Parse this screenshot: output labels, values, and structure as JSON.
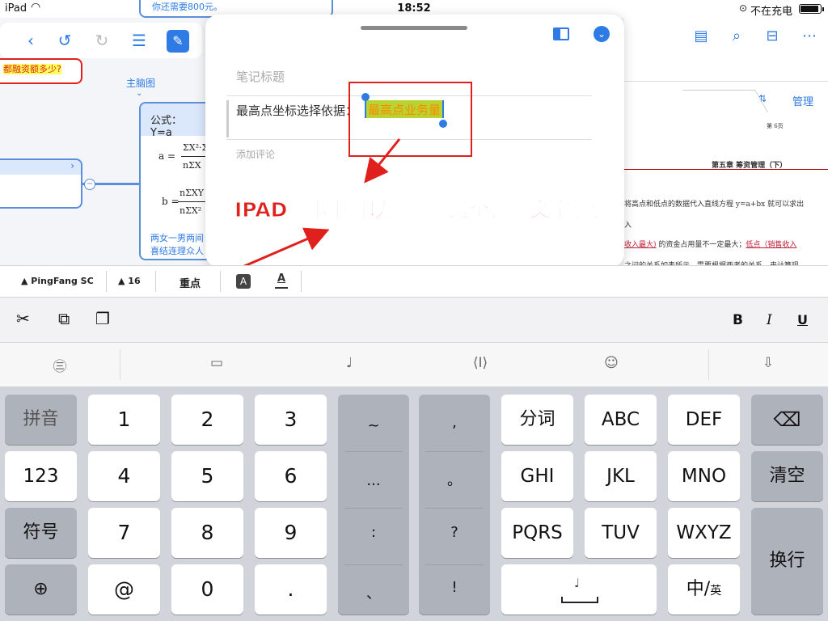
{
  "status_bar": {
    "device": "iPad",
    "time": "18:52",
    "battery_text": "不在充电"
  },
  "mindmap": {
    "top_note": "你还需要800元。",
    "left_node_text": "都融资额多少?",
    "branch_label": "主脑图",
    "formula_title": "公式：Y=a",
    "formula_a_prefix": "a =",
    "formula_a_num": "ΣX²·Σ",
    "formula_a_den": "nΣX",
    "formula_b_prefix": "b =",
    "formula_b_num": "nΣXY",
    "formula_b_den": "nΣX²",
    "node_text_line1": "两女一男两间",
    "node_text_line2": "喜结连理众人"
  },
  "document": {
    "manage_label": "管理",
    "page_label": "第 6页",
    "chapter_title": "第五章   筹资管理（下）",
    "line1": "将高点和低点的数据代入直线方程 y=a+bx 就可以求出",
    "line2": "入",
    "line3_link": "收入最大)",
    "line3_mid": " 的资金占用量不一定最大；",
    "line3_link2": "低点（销售收入",
    "line4": "之间的关系如表所示，需要根据两者的关系，来计算现"
  },
  "note_popup": {
    "title_placeholder": "笔记标题",
    "body_prefix": "最高点坐标选择依据：",
    "highlighted_text": "最高点业务量",
    "comment_placeholder": "添加评论"
  },
  "annotation": {
    "text": "IPAD版本中可以直接点这个设置文字底色"
  },
  "format_toolbar": {
    "font_name": "PingFang SC",
    "font_size": "16",
    "style_label": "重点",
    "bg_color_btn": "A",
    "text_color_btn": "A"
  },
  "edit_toolbar": {
    "bold": "B",
    "italic": "I",
    "underline": "U"
  },
  "keyboard": {
    "row1": {
      "pinyin": "拼音",
      "k1": "1",
      "k2": "2",
      "k3": "3",
      "fenci": "分词",
      "abc": "ABC",
      "def": "DEF"
    },
    "row2": {
      "num": "123",
      "k4": "4",
      "k5": "5",
      "k6": "6",
      "ghi": "GHI",
      "jkl": "JKL",
      "mno": "MNO",
      "clear": "清空"
    },
    "row3": {
      "symbol": "符号",
      "k7": "7",
      "k8": "8",
      "k9": "9",
      "pqrs": "PQRS",
      "tuv": "TUV",
      "wxyz": "WXYZ",
      "enter": "换行"
    },
    "row4": {
      "at": "@",
      "k0": "0",
      "dot": ".",
      "zh": "中",
      "en": "英"
    },
    "col_a": [
      "~",
      "...",
      ":",
      "、"
    ],
    "col_b": [
      ",",
      "。",
      "?",
      "!"
    ]
  },
  "colors": {
    "accent": "#2e7be6",
    "annotation_red": "#e0201c",
    "highlight_bg": "#b7d432",
    "highlight_text": "#ff8a00"
  }
}
